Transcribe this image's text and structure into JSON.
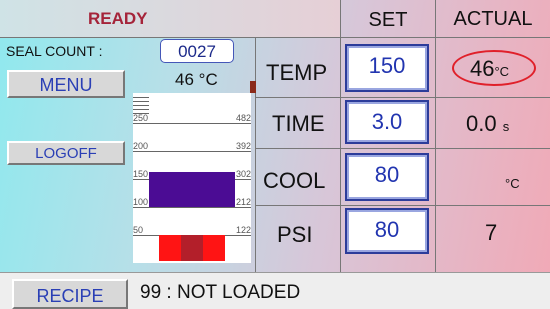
{
  "status": {
    "text": "READY",
    "color": "#a5243a"
  },
  "columns": {
    "set": "SET",
    "actual": "ACTUAL"
  },
  "seal_count": {
    "label": "SEAL COUNT :",
    "value": "0027"
  },
  "buttons": {
    "menu": "MENU",
    "logoff": "LOGOFF",
    "recipe": "RECIPE"
  },
  "temperature_readout": {
    "value": "46",
    "unit": "°C"
  },
  "gauge": {
    "ticks_left": [
      "250",
      "200",
      "150",
      "100",
      "50"
    ],
    "ticks_right": [
      "482",
      "392",
      "302",
      "212",
      "122"
    ],
    "scale_min": 0,
    "scale_max": 300,
    "bar_low": 100,
    "bar_high": 162,
    "heater_colors": [
      "#ff1414",
      "#b31f2a",
      "#ff1414"
    ]
  },
  "params": [
    {
      "id": "temp",
      "label": "TEMP",
      "set": "150",
      "actual": "46",
      "unit": "°C"
    },
    {
      "id": "time",
      "label": "TIME",
      "set": "3.0",
      "actual": "0.0",
      "unit": "s"
    },
    {
      "id": "cool",
      "label": "COOL",
      "set": "80",
      "actual": "",
      "unit": "°C"
    },
    {
      "id": "psi",
      "label": "PSI",
      "set": "80",
      "actual": "7",
      "unit": ""
    }
  ],
  "recipe": {
    "number": "99",
    "separator": ":",
    "status": "NOT LOADED"
  }
}
